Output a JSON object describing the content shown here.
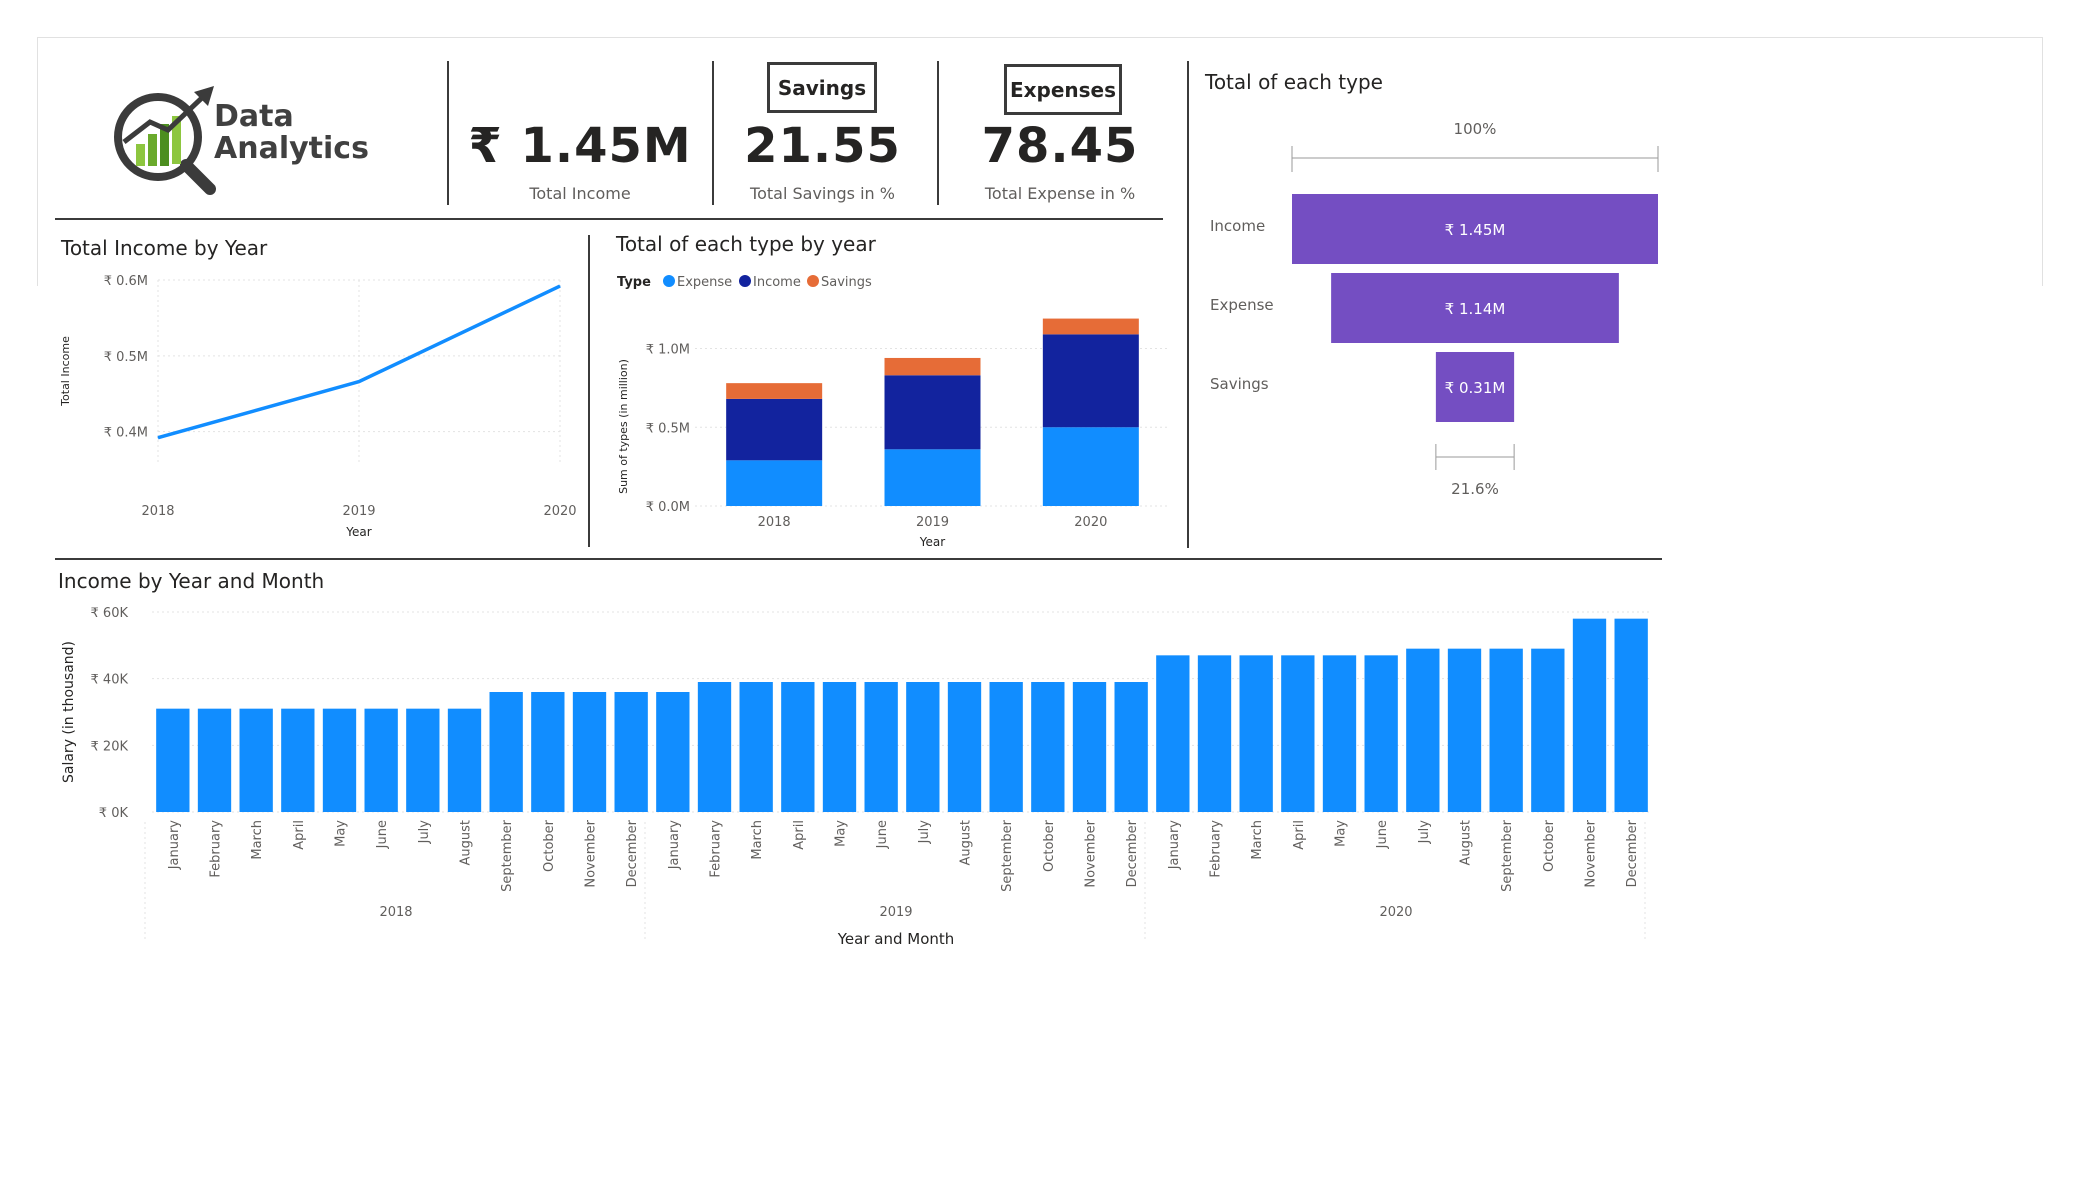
{
  "logo": {
    "line1": "Data",
    "line2": "Analytics"
  },
  "kpis": {
    "income": {
      "value": "₹ 1.45M",
      "label": "Total Income"
    },
    "savings": {
      "badge": "Savings",
      "value": "21.55",
      "label": "Total Savings in %"
    },
    "expense": {
      "badge": "Expenses",
      "value": "78.45",
      "label": "Total Expense in %"
    }
  },
  "colors": {
    "expense": "#118dff",
    "income": "#12239e",
    "savings": "#e66c37",
    "funnel": "#744ec2",
    "line": "#118dff"
  },
  "line_chart": {
    "title": "Total Income by Year",
    "xlabel": "Year",
    "ylabel": "Total Income",
    "chart_data": {
      "type": "line",
      "x": [
        "2018",
        "2019",
        "2020"
      ],
      "values": [
        0.392,
        0.466,
        0.592
      ],
      "ylim": [
        0.36,
        0.6
      ],
      "yticks": [
        {
          "v": 0.4,
          "label": "₹ 0.4M"
        },
        {
          "v": 0.5,
          "label": "₹ 0.5M"
        },
        {
          "v": 0.6,
          "label": "₹ 0.6M"
        }
      ],
      "grid": true
    }
  },
  "stack_chart": {
    "title": "Total of each type by year",
    "legend_title": "Type",
    "xlabel": "Year",
    "ylabel": "Sum of types (in million)",
    "chart_data": {
      "type": "bar",
      "stacked": true,
      "categories": [
        "2018",
        "2019",
        "2020"
      ],
      "series": [
        {
          "name": "Expense",
          "values": [
            0.29,
            0.36,
            0.5
          ]
        },
        {
          "name": "Income",
          "values": [
            0.39,
            0.47,
            0.59
          ]
        },
        {
          "name": "Savings",
          "values": [
            0.1,
            0.11,
            0.1
          ]
        }
      ],
      "ylim": [
        0,
        1.2
      ],
      "yticks": [
        {
          "v": 0,
          "label": "₹ 0.0M"
        },
        {
          "v": 0.5,
          "label": "₹ 0.5M"
        },
        {
          "v": 1.0,
          "label": "₹ 1.0M"
        }
      ],
      "legend": "top-left"
    }
  },
  "funnel": {
    "title": "Total of each type",
    "top_pct": "100%",
    "bottom_pct": "21.6%",
    "chart_data": {
      "type": "bar",
      "categories": [
        "Income",
        "Expense",
        "Savings"
      ],
      "values": [
        1.45,
        1.14,
        0.31
      ],
      "labels": [
        "₹ 1.45M",
        "₹ 1.14M",
        "₹ 0.31M"
      ]
    }
  },
  "monthly": {
    "title": "Income by Year and Month",
    "xlabel": "Year and Month",
    "ylabel": "Salary (in thousand)",
    "months": [
      "January",
      "February",
      "March",
      "April",
      "May",
      "June",
      "July",
      "August",
      "September",
      "October",
      "November",
      "December"
    ],
    "years": [
      "2018",
      "2019",
      "2020"
    ],
    "chart_data": {
      "type": "bar",
      "values": [
        31,
        31,
        31,
        31,
        31,
        31,
        31,
        31,
        36,
        36,
        36,
        36,
        36,
        39,
        39,
        39,
        39,
        39,
        39,
        39,
        39,
        39,
        39,
        39,
        47,
        47,
        47,
        47,
        47,
        47,
        49,
        49,
        49,
        49,
        58,
        58
      ],
      "ylim": [
        0,
        60
      ],
      "yticks": [
        {
          "v": 0,
          "label": "₹ 0K"
        },
        {
          "v": 20,
          "label": "₹ 20K"
        },
        {
          "v": 40,
          "label": "₹ 40K"
        },
        {
          "v": 60,
          "label": "₹ 60K"
        }
      ]
    }
  }
}
